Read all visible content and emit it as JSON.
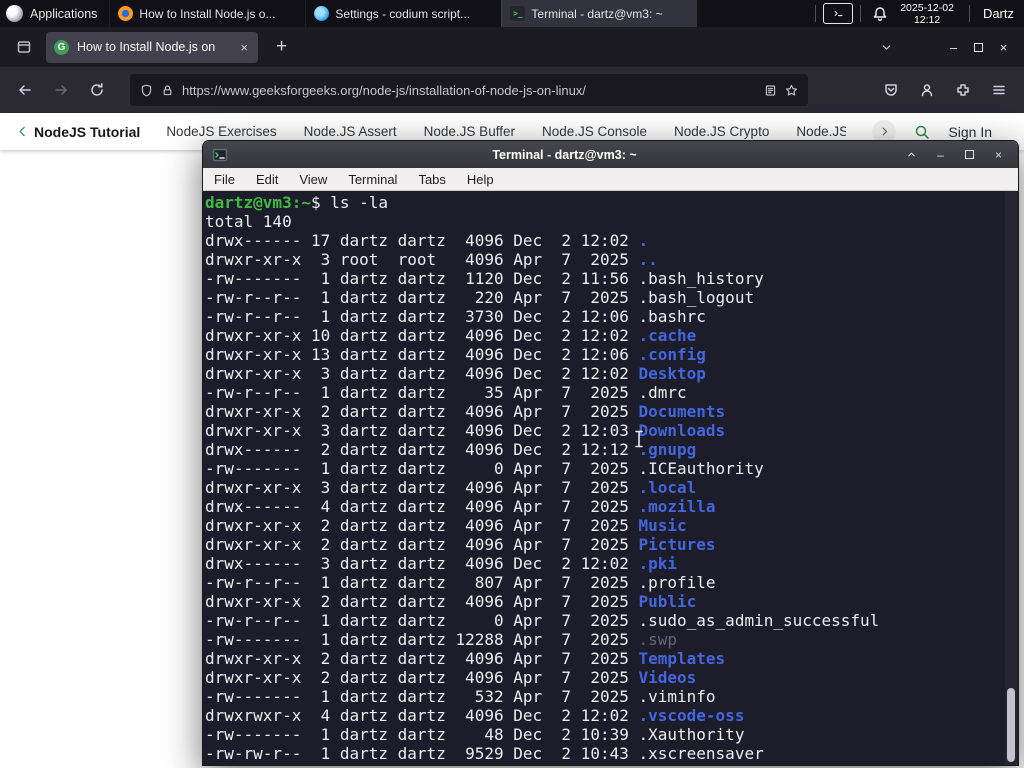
{
  "panel": {
    "applications_label": "Applications",
    "windows": [
      {
        "title": "How to Install Node.js o...",
        "icon": "firefox",
        "active": false
      },
      {
        "title": "Settings - codium script...",
        "icon": "codium",
        "active": false
      },
      {
        "title": "Terminal - dartz@vm3: ~",
        "icon": "terminal",
        "active": true
      }
    ],
    "clock_date": "2025-12-02",
    "clock_time": "12:12",
    "user_label": "Dartz"
  },
  "browser": {
    "tab": {
      "title": "How to Install Node.js on",
      "favicon_letter": "G"
    },
    "new_tab_label": "+",
    "url": "https://www.geeksforgeeks.org/node-js/installation-of-node-js-on-linux/",
    "site_nav": {
      "back_item": "NodeJS Tutorial",
      "items": [
        "NodeJS Exercises",
        "Node.JS Assert",
        "Node.JS Buffer",
        "Node.JS Console",
        "Node.JS Crypto",
        "Node.JS DNS",
        "Node"
      ],
      "sign_in": "Sign In"
    }
  },
  "terminal": {
    "title": "Terminal - dartz@vm3: ~",
    "menu": [
      "File",
      "Edit",
      "View",
      "Terminal",
      "Tabs",
      "Help"
    ],
    "prompt_user": "dartz@vm3",
    "prompt_path": ":~",
    "prompt_symbol": "$",
    "command": "ls -la",
    "total_line": "total 140",
    "listing": [
      {
        "meta": "drwx------ 17 dartz dartz  4096 Dec  2 12:02 ",
        "name": ".",
        "type": "dir"
      },
      {
        "meta": "drwxr-xr-x  3 root  root   4096 Apr  7  2025 ",
        "name": "..",
        "type": "dir"
      },
      {
        "meta": "-rw-------  1 dartz dartz  1120 Dec  2 11:56 ",
        "name": ".bash_history",
        "type": "file"
      },
      {
        "meta": "-rw-r--r--  1 dartz dartz   220 Apr  7  2025 ",
        "name": ".bash_logout",
        "type": "file"
      },
      {
        "meta": "-rw-r--r--  1 dartz dartz  3730 Dec  2 12:06 ",
        "name": ".bashrc",
        "type": "file"
      },
      {
        "meta": "drwxr-xr-x 10 dartz dartz  4096 Dec  2 12:02 ",
        "name": ".cache",
        "type": "dir"
      },
      {
        "meta": "drwxr-xr-x 13 dartz dartz  4096 Dec  2 12:06 ",
        "name": ".config",
        "type": "dir"
      },
      {
        "meta": "drwxr-xr-x  3 dartz dartz  4096 Dec  2 12:02 ",
        "name": "Desktop",
        "type": "dir"
      },
      {
        "meta": "-rw-r--r--  1 dartz dartz    35 Apr  7  2025 ",
        "name": ".dmrc",
        "type": "file"
      },
      {
        "meta": "drwxr-xr-x  2 dartz dartz  4096 Apr  7  2025 ",
        "name": "Documents",
        "type": "dir"
      },
      {
        "meta": "drwxr-xr-x  3 dartz dartz  4096 Dec  2 12:03 ",
        "name": "Downloads",
        "type": "dir"
      },
      {
        "meta": "drwx------  2 dartz dartz  4096 Dec  2 12:12 ",
        "name": ".gnupg",
        "type": "dir"
      },
      {
        "meta": "-rw-------  1 dartz dartz     0 Apr  7  2025 ",
        "name": ".ICEauthority",
        "type": "file"
      },
      {
        "meta": "drwxr-xr-x  3 dartz dartz  4096 Apr  7  2025 ",
        "name": ".local",
        "type": "dir"
      },
      {
        "meta": "drwx------  4 dartz dartz  4096 Apr  7  2025 ",
        "name": ".mozilla",
        "type": "dir"
      },
      {
        "meta": "drwxr-xr-x  2 dartz dartz  4096 Apr  7  2025 ",
        "name": "Music",
        "type": "dir"
      },
      {
        "meta": "drwxr-xr-x  2 dartz dartz  4096 Apr  7  2025 ",
        "name": "Pictures",
        "type": "dir"
      },
      {
        "meta": "drwx------  3 dartz dartz  4096 Dec  2 12:02 ",
        "name": ".pki",
        "type": "dir"
      },
      {
        "meta": "-rw-r--r--  1 dartz dartz   807 Apr  7  2025 ",
        "name": ".profile",
        "type": "file"
      },
      {
        "meta": "drwxr-xr-x  2 dartz dartz  4096 Apr  7  2025 ",
        "name": "Public",
        "type": "dir"
      },
      {
        "meta": "-rw-r--r--  1 dartz dartz     0 Apr  7  2025 ",
        "name": ".sudo_as_admin_successful",
        "type": "file"
      },
      {
        "meta": "-rw-------  1 dartz dartz 12288 Apr  7  2025 ",
        "name": ".swp",
        "type": "dim"
      },
      {
        "meta": "drwxr-xr-x  2 dartz dartz  4096 Apr  7  2025 ",
        "name": "Templates",
        "type": "dir"
      },
      {
        "meta": "drwxr-xr-x  2 dartz dartz  4096 Apr  7  2025 ",
        "name": "Videos",
        "type": "dir"
      },
      {
        "meta": "-rw-------  1 dartz dartz   532 Apr  7  2025 ",
        "name": ".viminfo",
        "type": "file"
      },
      {
        "meta": "drwxrwxr-x  4 dartz dartz  4096 Dec  2 12:02 ",
        "name": ".vscode-oss",
        "type": "dir"
      },
      {
        "meta": "-rw-------  1 dartz dartz    48 Dec  2 10:39 ",
        "name": ".Xauthority",
        "type": "file"
      },
      {
        "meta": "-rw-rw-r--  1 dartz dartz  9529 Dec  2 10:43 ",
        "name": ".xscreensaver",
        "type": "file"
      }
    ]
  },
  "colors": {
    "gfg_green": "#2f8d46",
    "terminal_bg": "#1c1c2a",
    "terminal_dir_blue": "#4466dd",
    "terminal_prompt_green": "#3fbc3f",
    "firefox_toolbar": "#2b2a33",
    "panel_bg": "#101016"
  }
}
